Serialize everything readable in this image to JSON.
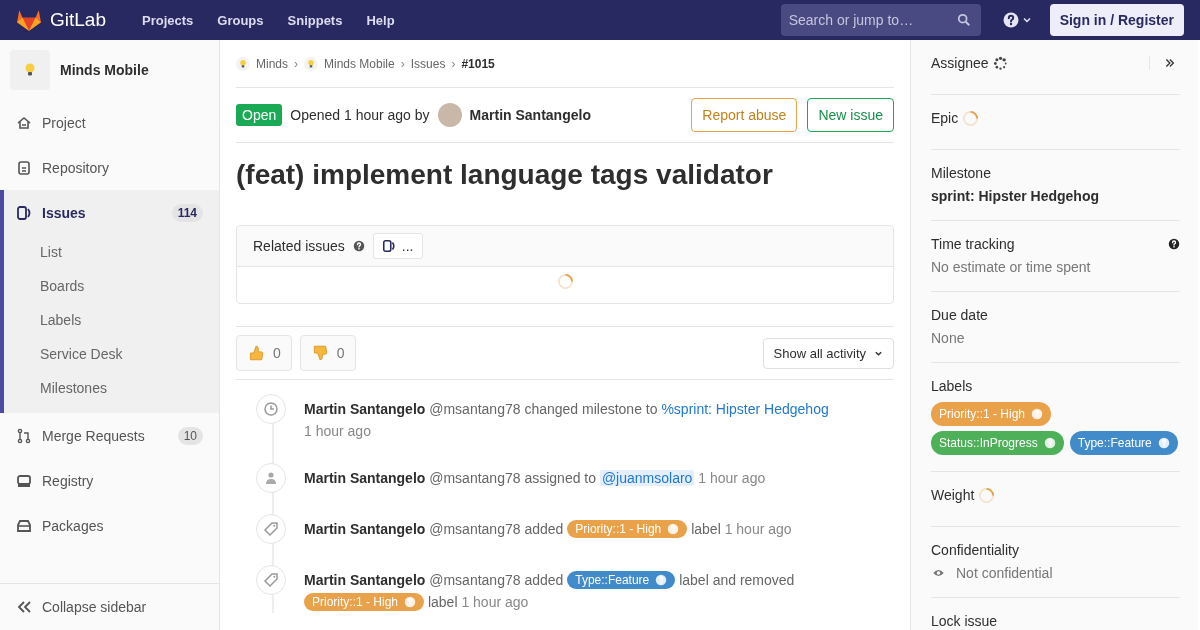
{
  "header": {
    "brand": "GitLab",
    "nav": [
      "Projects",
      "Groups",
      "Snippets",
      "Help"
    ],
    "search": {
      "placeholder": "Search or jump to…"
    },
    "sign_in": "Sign in / Register"
  },
  "sidebar": {
    "project": "Minds Mobile",
    "items": [
      {
        "label": "Project",
        "selected": false
      },
      {
        "label": "Repository",
        "selected": false
      },
      {
        "label": "Issues",
        "count": "114",
        "selected": true,
        "children": [
          "List",
          "Boards",
          "Labels",
          "Service Desk",
          "Milestones"
        ]
      },
      {
        "label": "Merge Requests",
        "count": "10",
        "selected": false
      },
      {
        "label": "Registry",
        "selected": false
      },
      {
        "label": "Packages",
        "selected": false
      }
    ],
    "collapse": "Collapse sidebar"
  },
  "breadcrumbs": [
    {
      "text": "Minds",
      "kind": "group"
    },
    {
      "sep": "›",
      "text": "Minds Mobile",
      "kind": "group"
    },
    {
      "sep": "›",
      "text": "Issues",
      "kind": "plain"
    },
    {
      "sep": "›",
      "text": "#1015",
      "kind": "current"
    }
  ],
  "issue": {
    "status": "Open",
    "opened": "Opened 1 hour ago by",
    "author": "Martin Santangelo",
    "report": "Report abuse",
    "new": "New issue",
    "title": "(feat) implement language tags validator"
  },
  "related": {
    "title": "Related issues",
    "count": "..."
  },
  "awards": [
    {
      "kind": "up",
      "count": "0"
    },
    {
      "kind": "down",
      "count": "0"
    }
  ],
  "activity_filter": "Show all activity",
  "events": [
    {
      "kind": "milestone",
      "parts": [
        {
          "kind": "author",
          "text": "Martin Santangelo"
        },
        {
          "kind": "text",
          "text": "@msantang78 changed milestone to"
        },
        {
          "kind": "link",
          "text": "%sprint: Hipster Hedgehog"
        },
        {
          "kind": "time",
          "text": "1 hour ago"
        }
      ]
    },
    {
      "kind": "assignee",
      "parts": [
        {
          "kind": "author",
          "text": "Martin Santangelo"
        },
        {
          "kind": "text",
          "text": "@msantang78 assigned to"
        },
        {
          "kind": "mention",
          "text": "@juanmsolaro"
        },
        {
          "kind": "time",
          "text": "1 hour ago"
        }
      ]
    },
    {
      "kind": "label",
      "parts": [
        {
          "kind": "author",
          "text": "Martin Santangelo"
        },
        {
          "kind": "text",
          "text": "@msantang78 added"
        },
        {
          "kind": "label",
          "text": "Priority::1 - High",
          "color": "#e9a14a"
        },
        {
          "kind": "text",
          "text": "label"
        },
        {
          "kind": "time",
          "text": "1 hour ago"
        }
      ]
    },
    {
      "kind": "label",
      "parts": [
        {
          "kind": "author",
          "text": "Martin Santangelo"
        },
        {
          "kind": "text",
          "text": "@msantang78 added"
        },
        {
          "kind": "label",
          "text": "Type::Feature",
          "color": "#428bca"
        },
        {
          "kind": "text",
          "text": "label and removed"
        },
        {
          "kind": "label",
          "text": "Priority::1 - High",
          "color": "#e9a14a"
        },
        {
          "kind": "text",
          "text": "label"
        },
        {
          "kind": "time",
          "text": "1 hour ago"
        }
      ]
    }
  ],
  "right": {
    "sections": [
      {
        "kind": "pending",
        "title": "Assignee"
      },
      {
        "kind": "loading",
        "title": "Epic"
      },
      {
        "kind": "strong",
        "title": "Milestone",
        "value": "sprint: Hipster Hedgehog"
      },
      {
        "kind": "tracked",
        "title": "Time tracking",
        "value": "No estimate or time spent"
      },
      {
        "kind": "value",
        "title": "Due date",
        "value": "None"
      },
      {
        "kind": "labels",
        "title": "Labels",
        "labels": [
          {
            "text": "Priority::1 - High",
            "color": "#e9a14a"
          },
          {
            "text": "Status::InProgress",
            "color": "#4fb05a"
          },
          {
            "text": "Type::Feature",
            "color": "#428bca"
          }
        ]
      },
      {
        "kind": "loading",
        "title": "Weight"
      },
      {
        "kind": "confidential",
        "title": "Confidentiality",
        "value": "Not confidential"
      },
      {
        "kind": "title",
        "title": "Lock issue"
      }
    ]
  }
}
